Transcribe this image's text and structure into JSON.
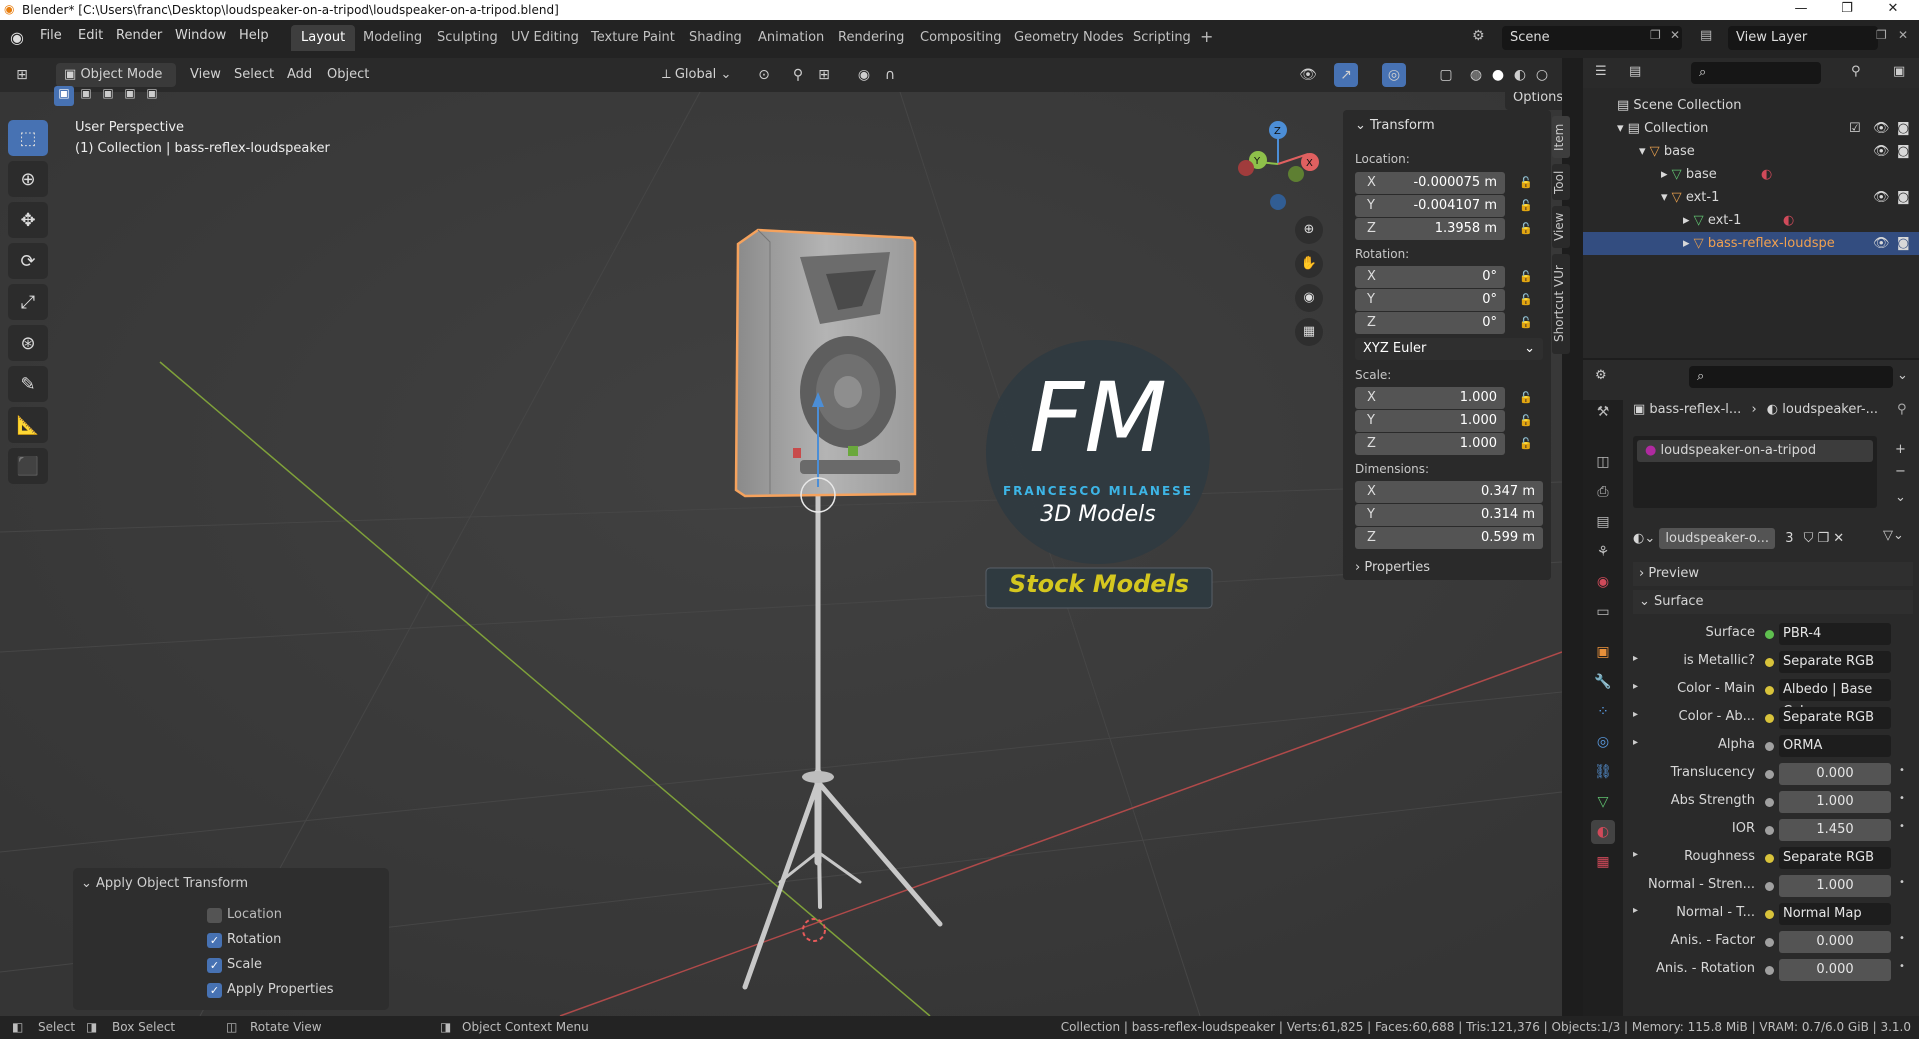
{
  "titlebar": {
    "title": "Blender* [C:\\Users\\franc\\Desktop\\loudspeaker-on-a-tripod\\loudspeaker-on-a-tripod.blend]"
  },
  "menu": [
    "File",
    "Edit",
    "Render",
    "Window",
    "Help"
  ],
  "workspaces": [
    "Layout",
    "Modeling",
    "Sculpting",
    "UV Editing",
    "Texture Paint",
    "Shading",
    "Animation",
    "Rendering",
    "Compositing",
    "Geometry Nodes",
    "Scripting"
  ],
  "scene": {
    "name": "Scene",
    "view_layer": "View Layer"
  },
  "header": {
    "mode": "Object Mode",
    "menus": [
      "View",
      "Select",
      "Add",
      "Object"
    ],
    "orientation": "Global",
    "options": "Options"
  },
  "viewport": {
    "perspective": "User Perspective",
    "collection_info": "(1) Collection | bass-reflex-loudspeaker"
  },
  "watermark": {
    "initials": "FM",
    "author": "FRANCESCO MILANESE",
    "line2": "3D Models",
    "line3": "Stock Models"
  },
  "npanel": {
    "section": "Transform",
    "location_label": "Location:",
    "location": [
      {
        "axis": "X",
        "value": "-0.000075 m"
      },
      {
        "axis": "Y",
        "value": "-0.004107 m"
      },
      {
        "axis": "Z",
        "value": "1.3958 m"
      }
    ],
    "rotation_label": "Rotation:",
    "rotation": [
      {
        "axis": "X",
        "value": "0°"
      },
      {
        "axis": "Y",
        "value": "0°"
      },
      {
        "axis": "Z",
        "value": "0°"
      }
    ],
    "rotation_mode": "XYZ Euler",
    "scale_label": "Scale:",
    "scale": [
      {
        "axis": "X",
        "value": "1.000"
      },
      {
        "axis": "Y",
        "value": "1.000"
      },
      {
        "axis": "Z",
        "value": "1.000"
      }
    ],
    "dimensions_label": "Dimensions:",
    "dimensions": [
      {
        "axis": "X",
        "value": "0.347 m"
      },
      {
        "axis": "Y",
        "value": "0.314 m"
      },
      {
        "axis": "Z",
        "value": "0.599 m"
      }
    ],
    "properties": "Properties",
    "tabs": [
      "Item",
      "Tool",
      "View",
      "Shortcut VUr"
    ]
  },
  "redo_panel": {
    "title": "Apply Object Transform",
    "options": [
      {
        "label": "Location",
        "checked": false
      },
      {
        "label": "Rotation",
        "checked": true
      },
      {
        "label": "Scale",
        "checked": true
      },
      {
        "label": "Apply Properties",
        "checked": true
      }
    ]
  },
  "outliner": {
    "rows": [
      "Scene Collection",
      "Collection",
      "base",
      "base",
      "ext-1",
      "ext-1",
      "bass-reflex-loudspe"
    ]
  },
  "properties": {
    "breadcrumb_obj": "bass-reflex-l...",
    "breadcrumb_mat": "loudspeaker-...",
    "slot": "loudspeaker-on-a-tripod",
    "material": "loudspeaker-o...",
    "users": "3",
    "preview": "Preview",
    "surface_panel": "Surface",
    "rows": [
      {
        "label": "Surface",
        "value": "PBR-4",
        "kind": "link",
        "color": "#5fbf4f",
        "expand": false
      },
      {
        "label": "is Metallic?",
        "value": "Separate RGB",
        "kind": "link",
        "color": "#d8c33b",
        "expand": true
      },
      {
        "label": "Color - Main",
        "value": "Albedo | Base Color",
        "kind": "link",
        "color": "#d8c33b",
        "expand": true
      },
      {
        "label": "Color - Ab...",
        "value": "Separate RGB",
        "kind": "link",
        "color": "#d8c33b",
        "expand": true
      },
      {
        "label": "Alpha",
        "value": "ORMA",
        "kind": "link",
        "color": "#a0a0a0",
        "expand": true
      },
      {
        "label": "Translucency",
        "value": "0.000",
        "kind": "num",
        "color": "#a0a0a0",
        "expand": false
      },
      {
        "label": "Abs Strength",
        "value": "1.000",
        "kind": "num",
        "color": "#a0a0a0",
        "expand": false
      },
      {
        "label": "IOR",
        "value": "1.450",
        "kind": "num",
        "color": "#a0a0a0",
        "expand": false
      },
      {
        "label": "Roughness",
        "value": "Separate RGB",
        "kind": "link",
        "color": "#d8c33b",
        "expand": true
      },
      {
        "label": "Normal - Stren...",
        "value": "1.000",
        "kind": "num",
        "color": "#a0a0a0",
        "expand": false
      },
      {
        "label": "Normal - T...",
        "value": "Normal Map",
        "kind": "link",
        "color": "#d8c33b",
        "expand": true
      },
      {
        "label": "Anis. - Factor",
        "value": "0.000",
        "kind": "num",
        "color": "#a0a0a0",
        "expand": false
      },
      {
        "label": "Anis. - Rotation",
        "value": "0.000",
        "kind": "num",
        "color": "#a0a0a0",
        "expand": false
      }
    ]
  },
  "status": {
    "select": "Select",
    "box_select": "Box Select",
    "rotate_view": "Rotate View",
    "context_menu": "Object Context Menu",
    "info": "Collection | bass-reflex-loudspeaker | Verts:61,825 | Faces:60,688 | Tris:121,376 | Objects:1/3 | Memory: 115.8 MiB | VRAM: 0.7/6.0 GiB | 3.1.0"
  },
  "colors": {
    "accent": "#4772b3",
    "selection": "#f5a25d",
    "x_axis": "#e06060",
    "y_axis": "#8ec04a",
    "z_axis": "#4c8ed6"
  }
}
